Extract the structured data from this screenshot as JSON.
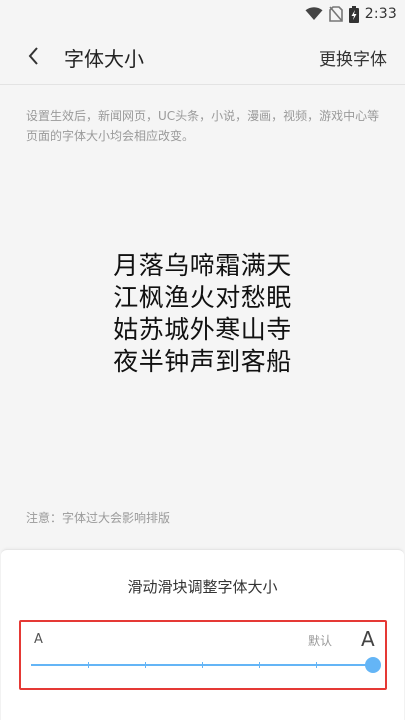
{
  "status_bar": {
    "time": "2:33",
    "icons": [
      "wifi-icon",
      "no-sim-icon",
      "battery-charging-icon"
    ]
  },
  "header": {
    "title": "字体大小",
    "action_label": "更换字体",
    "back_icon": "chevron-left-icon"
  },
  "description": "设置生效后，新闻网页，UC头条，小说，漫画，视频，游戏中心等页面的字体大小均会相应改变。",
  "poem": {
    "lines": [
      "月落乌啼霜满天",
      "江枫渔火对愁眠",
      "姑苏城外寒山寺",
      "夜半钟声到客船"
    ]
  },
  "notice": "注意：字体过大会影响排版",
  "panel": {
    "title": "滑动滑块调整字体大小",
    "slider": {
      "small_label": "A",
      "default_label": "默认",
      "large_label": "A",
      "steps": 7,
      "value_step": 6,
      "default_step": 5,
      "accent_color": "#64b5f6",
      "highlight_color": "#e53935"
    }
  }
}
